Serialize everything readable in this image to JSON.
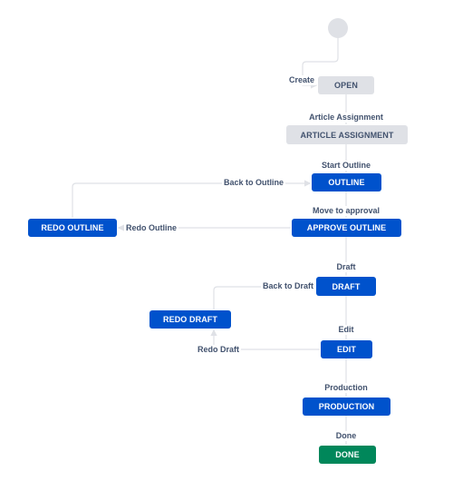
{
  "colors": {
    "todo": "#dfe1e6",
    "in_progress": "#0052cc",
    "done": "#00875a",
    "connector": "#dfe1e6",
    "label_text": "#42526e"
  },
  "start_node": {
    "icon": "start-circle"
  },
  "statuses": [
    {
      "id": "open",
      "label": "OPEN",
      "category": "todo"
    },
    {
      "id": "article-assignment",
      "label": "ARTICLE ASSIGNMENT",
      "category": "todo"
    },
    {
      "id": "outline",
      "label": "OUTLINE",
      "category": "inprogress"
    },
    {
      "id": "approve-outline",
      "label": "APPROVE OUTLINE",
      "category": "inprogress"
    },
    {
      "id": "redo-outline",
      "label": "REDO OUTLINE",
      "category": "inprogress"
    },
    {
      "id": "draft",
      "label": "DRAFT",
      "category": "inprogress"
    },
    {
      "id": "redo-draft",
      "label": "REDO DRAFT",
      "category": "inprogress"
    },
    {
      "id": "edit",
      "label": "EDIT",
      "category": "inprogress"
    },
    {
      "id": "production",
      "label": "PRODUCTION",
      "category": "inprogress"
    },
    {
      "id": "done",
      "label": "DONE",
      "category": "done"
    }
  ],
  "transitions": [
    {
      "id": "create",
      "label": "Create",
      "from": "start",
      "to": "open"
    },
    {
      "id": "article-assignment",
      "label": "Article Assignment",
      "from": "open",
      "to": "article-assignment"
    },
    {
      "id": "start-outline",
      "label": "Start Outline",
      "from": "article-assignment",
      "to": "outline"
    },
    {
      "id": "back-to-outline",
      "label": "Back to Outline",
      "from": "redo-outline",
      "to": "outline"
    },
    {
      "id": "move-to-approval",
      "label": "Move to approval",
      "from": "outline",
      "to": "approve-outline"
    },
    {
      "id": "redo-outline",
      "label": "Redo Outline",
      "from": "approve-outline",
      "to": "redo-outline"
    },
    {
      "id": "draft",
      "label": "Draft",
      "from": "approve-outline",
      "to": "draft"
    },
    {
      "id": "back-to-draft",
      "label": "Back to Draft",
      "from": "redo-draft",
      "to": "draft"
    },
    {
      "id": "edit",
      "label": "Edit",
      "from": "draft",
      "to": "edit"
    },
    {
      "id": "redo-draft",
      "label": "Redo Draft",
      "from": "edit",
      "to": "redo-draft"
    },
    {
      "id": "production",
      "label": "Production",
      "from": "edit",
      "to": "production"
    },
    {
      "id": "done",
      "label": "Done",
      "from": "production",
      "to": "done"
    }
  ]
}
